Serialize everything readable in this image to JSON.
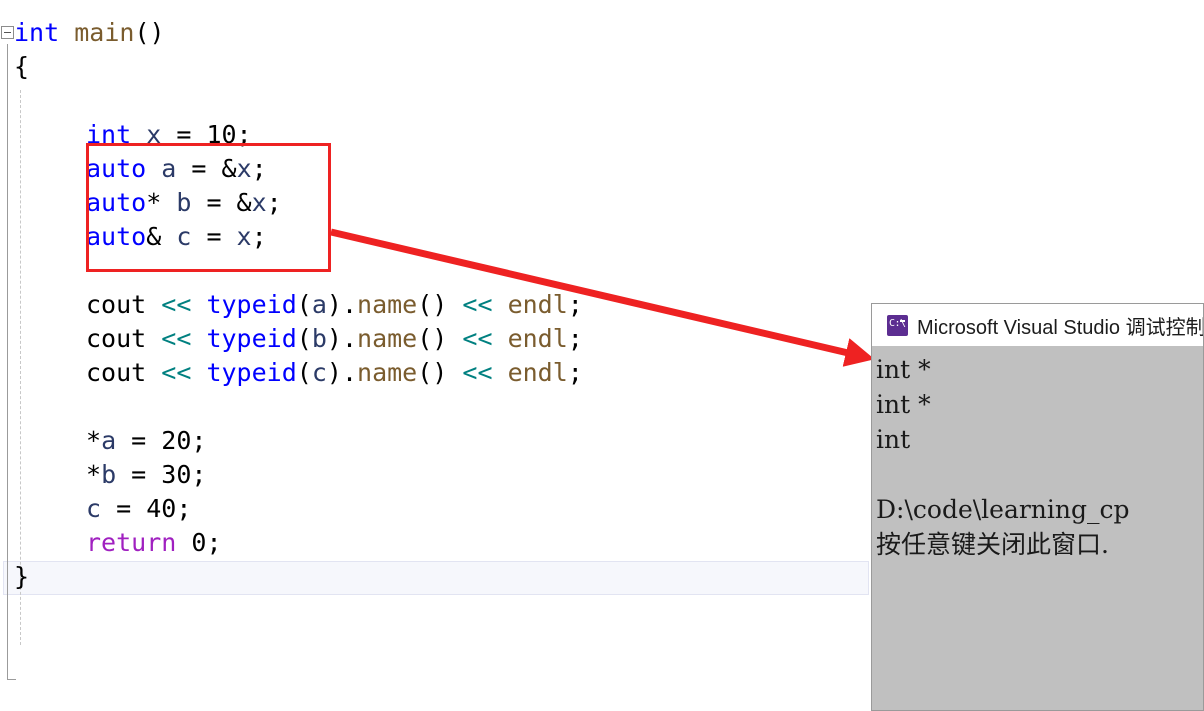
{
  "editor": {
    "fold_marker": "minus",
    "lines": [
      {
        "indent": 0,
        "tokens": [
          {
            "t": "int",
            "c": "kw"
          },
          {
            "t": " ",
            "c": "plain"
          },
          {
            "t": "main",
            "c": "member"
          },
          {
            "t": "()",
            "c": "plain"
          }
        ]
      },
      {
        "indent": 0,
        "tokens": [
          {
            "t": "{",
            "c": "plain"
          }
        ]
      },
      {
        "indent": 1,
        "tokens": []
      },
      {
        "indent": 1,
        "tokens": [
          {
            "t": "int",
            "c": "kw"
          },
          {
            "t": " ",
            "c": "plain"
          },
          {
            "t": "x",
            "c": "ident"
          },
          {
            "t": " = ",
            "c": "plain"
          },
          {
            "t": "10",
            "c": "num"
          },
          {
            "t": ";",
            "c": "plain"
          }
        ]
      },
      {
        "indent": 1,
        "tokens": [
          {
            "t": "auto",
            "c": "kw"
          },
          {
            "t": " ",
            "c": "plain"
          },
          {
            "t": "a",
            "c": "ident"
          },
          {
            "t": " = ",
            "c": "plain"
          },
          {
            "t": "&",
            "c": "plain"
          },
          {
            "t": "x",
            "c": "ident"
          },
          {
            "t": ";",
            "c": "plain"
          }
        ]
      },
      {
        "indent": 1,
        "tokens": [
          {
            "t": "auto",
            "c": "kw"
          },
          {
            "t": "* ",
            "c": "plain"
          },
          {
            "t": "b",
            "c": "ident"
          },
          {
            "t": " = ",
            "c": "plain"
          },
          {
            "t": "&",
            "c": "plain"
          },
          {
            "t": "x",
            "c": "ident"
          },
          {
            "t": ";",
            "c": "plain"
          }
        ]
      },
      {
        "indent": 1,
        "tokens": [
          {
            "t": "auto",
            "c": "kw"
          },
          {
            "t": "& ",
            "c": "plain"
          },
          {
            "t": "c",
            "c": "ident"
          },
          {
            "t": " = ",
            "c": "plain"
          },
          {
            "t": "x",
            "c": "ident"
          },
          {
            "t": ";",
            "c": "plain"
          }
        ]
      },
      {
        "indent": 1,
        "tokens": []
      },
      {
        "indent": 1,
        "tokens": [
          {
            "t": "cout",
            "c": "plain"
          },
          {
            "t": " ",
            "c": "plain"
          },
          {
            "t": "<<",
            "c": "op"
          },
          {
            "t": " ",
            "c": "plain"
          },
          {
            "t": "typeid",
            "c": "func"
          },
          {
            "t": "(",
            "c": "plain"
          },
          {
            "t": "a",
            "c": "ident"
          },
          {
            "t": ")",
            "c": "plain"
          },
          {
            "t": ".",
            "c": "plain"
          },
          {
            "t": "name",
            "c": "member"
          },
          {
            "t": "() ",
            "c": "plain"
          },
          {
            "t": "<<",
            "c": "op"
          },
          {
            "t": " ",
            "c": "plain"
          },
          {
            "t": "endl",
            "c": "member"
          },
          {
            "t": ";",
            "c": "plain"
          }
        ]
      },
      {
        "indent": 1,
        "tokens": [
          {
            "t": "cout",
            "c": "plain"
          },
          {
            "t": " ",
            "c": "plain"
          },
          {
            "t": "<<",
            "c": "op"
          },
          {
            "t": " ",
            "c": "plain"
          },
          {
            "t": "typeid",
            "c": "func"
          },
          {
            "t": "(",
            "c": "plain"
          },
          {
            "t": "b",
            "c": "ident"
          },
          {
            "t": ")",
            "c": "plain"
          },
          {
            "t": ".",
            "c": "plain"
          },
          {
            "t": "name",
            "c": "member"
          },
          {
            "t": "() ",
            "c": "plain"
          },
          {
            "t": "<<",
            "c": "op"
          },
          {
            "t": " ",
            "c": "plain"
          },
          {
            "t": "endl",
            "c": "member"
          },
          {
            "t": ";",
            "c": "plain"
          }
        ]
      },
      {
        "indent": 1,
        "tokens": [
          {
            "t": "cout",
            "c": "plain"
          },
          {
            "t": " ",
            "c": "plain"
          },
          {
            "t": "<<",
            "c": "op"
          },
          {
            "t": " ",
            "c": "plain"
          },
          {
            "t": "typeid",
            "c": "func"
          },
          {
            "t": "(",
            "c": "plain"
          },
          {
            "t": "c",
            "c": "ident"
          },
          {
            "t": ")",
            "c": "plain"
          },
          {
            "t": ".",
            "c": "plain"
          },
          {
            "t": "name",
            "c": "member"
          },
          {
            "t": "() ",
            "c": "plain"
          },
          {
            "t": "<<",
            "c": "op"
          },
          {
            "t": " ",
            "c": "plain"
          },
          {
            "t": "endl",
            "c": "member"
          },
          {
            "t": ";",
            "c": "plain"
          }
        ]
      },
      {
        "indent": 1,
        "tokens": []
      },
      {
        "indent": 1,
        "tokens": [
          {
            "t": "*",
            "c": "plain"
          },
          {
            "t": "a",
            "c": "ident"
          },
          {
            "t": " = ",
            "c": "plain"
          },
          {
            "t": "20",
            "c": "num"
          },
          {
            "t": ";",
            "c": "plain"
          }
        ]
      },
      {
        "indent": 1,
        "tokens": [
          {
            "t": "*",
            "c": "plain"
          },
          {
            "t": "b",
            "c": "ident"
          },
          {
            "t": " = ",
            "c": "plain"
          },
          {
            "t": "30",
            "c": "num"
          },
          {
            "t": ";",
            "c": "plain"
          }
        ]
      },
      {
        "indent": 1,
        "tokens": [
          {
            "t": "c",
            "c": "ident"
          },
          {
            "t": " = ",
            "c": "plain"
          },
          {
            "t": "40",
            "c": "num"
          },
          {
            "t": ";",
            "c": "plain"
          }
        ]
      },
      {
        "indent": 1,
        "tokens": [
          {
            "t": "return",
            "c": "ctrl"
          },
          {
            "t": " ",
            "c": "plain"
          },
          {
            "t": "0",
            "c": "num"
          },
          {
            "t": ";",
            "c": "plain"
          }
        ]
      },
      {
        "indent": 0,
        "tokens": [
          {
            "t": "}",
            "c": "plain"
          }
        ]
      }
    ],
    "plain_text": {
      "line1": "int main()",
      "line2": "{",
      "line4": "int x = 10;",
      "line5": "auto a = &x;",
      "line6": "auto* b = &x;",
      "line7": "auto& c = x;",
      "line9": "cout << typeid(a).name() << endl;",
      "line10": "cout << typeid(b).name() << endl;",
      "line11": "cout << typeid(c).name() << endl;",
      "line13": "*a = 20;",
      "line14": "*b = 30;",
      "line15": "c = 40;",
      "line16": "return 0;",
      "line17": "}"
    },
    "current_line_text": "c = 40;"
  },
  "annotation": {
    "highlight_color": "#ee2222",
    "arrow_color": "#ee2222",
    "boxed_lines": [
      "auto a = &x;",
      "auto* b = &x;",
      "auto& c = x;"
    ]
  },
  "console": {
    "icon": "console-icon",
    "icon_prompt": "C:\\",
    "title": "Microsoft Visual Studio 调试控制台",
    "background_color": "#c0c0c0",
    "output_lines": [
      "int *",
      "int *",
      "int",
      "",
      "D:\\code\\learning_cp",
      "按任意键关闭此窗口."
    ]
  },
  "colors": {
    "keyword": "#0000ff",
    "identifier": "#2b3a67",
    "operator": "#008080",
    "member": "#7a5c2e",
    "control": "#a020c0",
    "plain": "#000000",
    "editor_bg": "#ffffff",
    "current_line_bg": "#f6f7fc"
  }
}
